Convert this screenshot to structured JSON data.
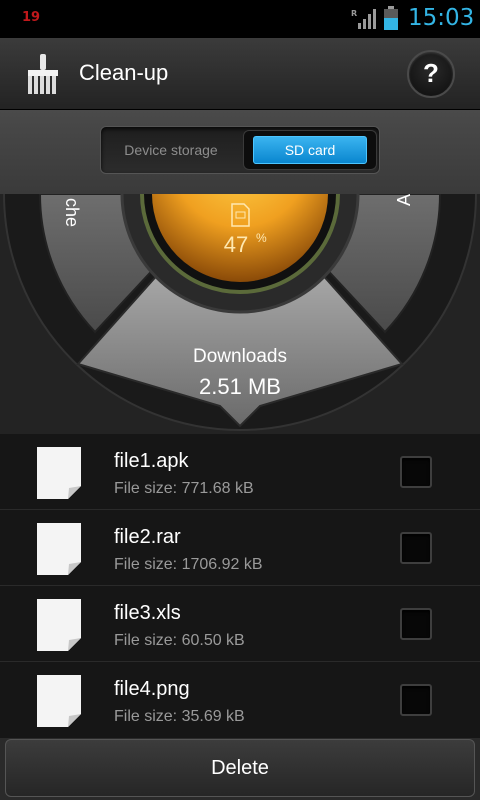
{
  "status_bar": {
    "notification_count": "19",
    "roaming_indicator": "R",
    "time": "15:03",
    "signal_icon": "signal-icon",
    "battery_icon": "battery-icon"
  },
  "action_bar": {
    "title": "Clean-up",
    "app_icon": "broom-icon",
    "help_label": "?"
  },
  "storage_toggle": {
    "options": [
      "Device storage",
      "SD card"
    ],
    "selected": "SD card"
  },
  "dial": {
    "center_icon": "sd-card-icon",
    "percent_value": "47",
    "percent_sign": "%",
    "left_segment_partial_label": "che",
    "right_segment_partial_label": "A",
    "active_segment": {
      "label": "Downloads",
      "value": "2.51 MB"
    }
  },
  "files": [
    {
      "name": "file1.apk",
      "size": "File size: 771.68 kB",
      "checked": false
    },
    {
      "name": "file2.rar",
      "size": "File size: 1706.92 kB",
      "checked": false
    },
    {
      "name": "file3.xls",
      "size": "File size: 60.50 kB",
      "checked": false
    },
    {
      "name": "file4.png",
      "size": "File size: 35.69 kB",
      "checked": false
    }
  ],
  "delete_label": "Delete",
  "colors": {
    "accent_blue": "#33b5e5",
    "toggle_blue": "#1a9be0",
    "gauge_orange": "#f0a020"
  }
}
